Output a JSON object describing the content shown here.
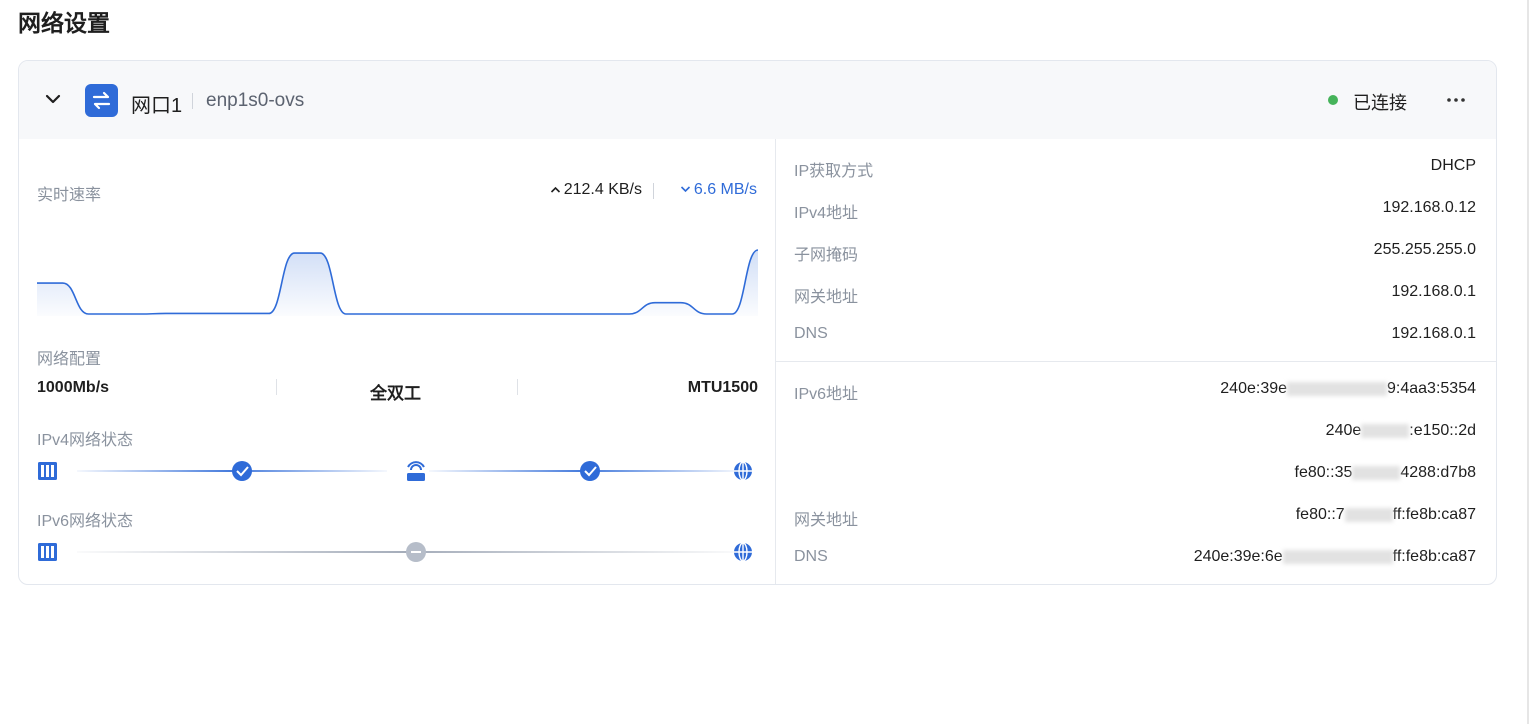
{
  "page": {
    "title": "网络设置"
  },
  "port": {
    "name": "网口1",
    "interface": "enp1s0-ovs",
    "status": "已连接",
    "colors": {
      "accent": "#2f6bd8",
      "connected": "#45b35a",
      "neutral": "#b6bdc9"
    }
  },
  "speed": {
    "label": "实时速率",
    "upload": "212.4 KB/s",
    "download": "6.6 MB/s",
    "chart_data": {
      "type": "area",
      "values": [
        30,
        30,
        0,
        0,
        0,
        0.5,
        0.5,
        0.5,
        0.5,
        0.5,
        59,
        59,
        0,
        0,
        0,
        0,
        0,
        0,
        0,
        0,
        0,
        0,
        0,
        0,
        11,
        11,
        0,
        0,
        62
      ],
      "ylim": [
        0,
        62
      ]
    }
  },
  "config": {
    "label": "网络配置",
    "speed": "1000Mb/s",
    "duplex": "全双工",
    "mtu": "MTU1500"
  },
  "ipv4_status": {
    "label": "IPv4网络状态"
  },
  "ipv6_status": {
    "label": "IPv6网络状态"
  },
  "ipv4_info": [
    {
      "label": "IP获取方式",
      "value": "DHCP"
    },
    {
      "label": "IPv4地址",
      "value": "192.168.0.12"
    },
    {
      "label": "子网掩码",
      "value": "255.255.255.0"
    },
    {
      "label": "网关地址",
      "value": "192.168.0.1"
    },
    {
      "label": "DNS",
      "value": "192.168.0.1"
    }
  ],
  "ipv6_info": {
    "address_label": "IPv6地址",
    "addresses": [
      {
        "prefix": "240e:39e",
        "suffix": "9:4aa3:5354"
      },
      {
        "prefix": "240e",
        "suffix": ":e150::2d"
      },
      {
        "prefix": "fe80::35",
        "suffix": "4288:d7b8"
      }
    ],
    "gateway_label": "网关地址",
    "gateway": {
      "prefix": "fe80::7",
      "suffix": "ff:fe8b:ca87"
    },
    "dns_label": "DNS",
    "dns": {
      "prefix": "240e:39e:6e",
      "suffix": "ff:fe8b:ca87"
    }
  }
}
